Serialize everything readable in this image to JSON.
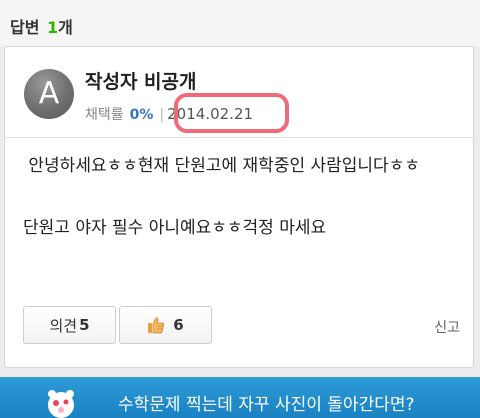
{
  "header": {
    "label": "답변",
    "count": "1",
    "suffix": "개"
  },
  "answer": {
    "avatar_letter": "A",
    "author": "작성자 비공개",
    "adoption_label": "채택률",
    "adoption_rate": "0%",
    "separator": "|",
    "date": "2014.02.21",
    "body": " 안녕하세요ㅎㅎ현재 단원고에 재학중인 사람입니다ㅎㅎ\n\n단원고 야자 필수 아니예요ㅎㅎ걱정 마세요",
    "opinion_label": "의견",
    "opinion_count": "5",
    "like_count": "6",
    "report_label": "신고"
  },
  "banner": {
    "text": "수학문제 찍는데 자꾸 사진이 돌아간다면?"
  },
  "colors": {
    "accent": "#2db400",
    "rate": "#3a75c4",
    "highlight": "#ee6b7a",
    "banner": "#2e9bd8"
  },
  "icons": {
    "like": "thumbs-up-icon",
    "mascot": "mascot-illustration"
  }
}
